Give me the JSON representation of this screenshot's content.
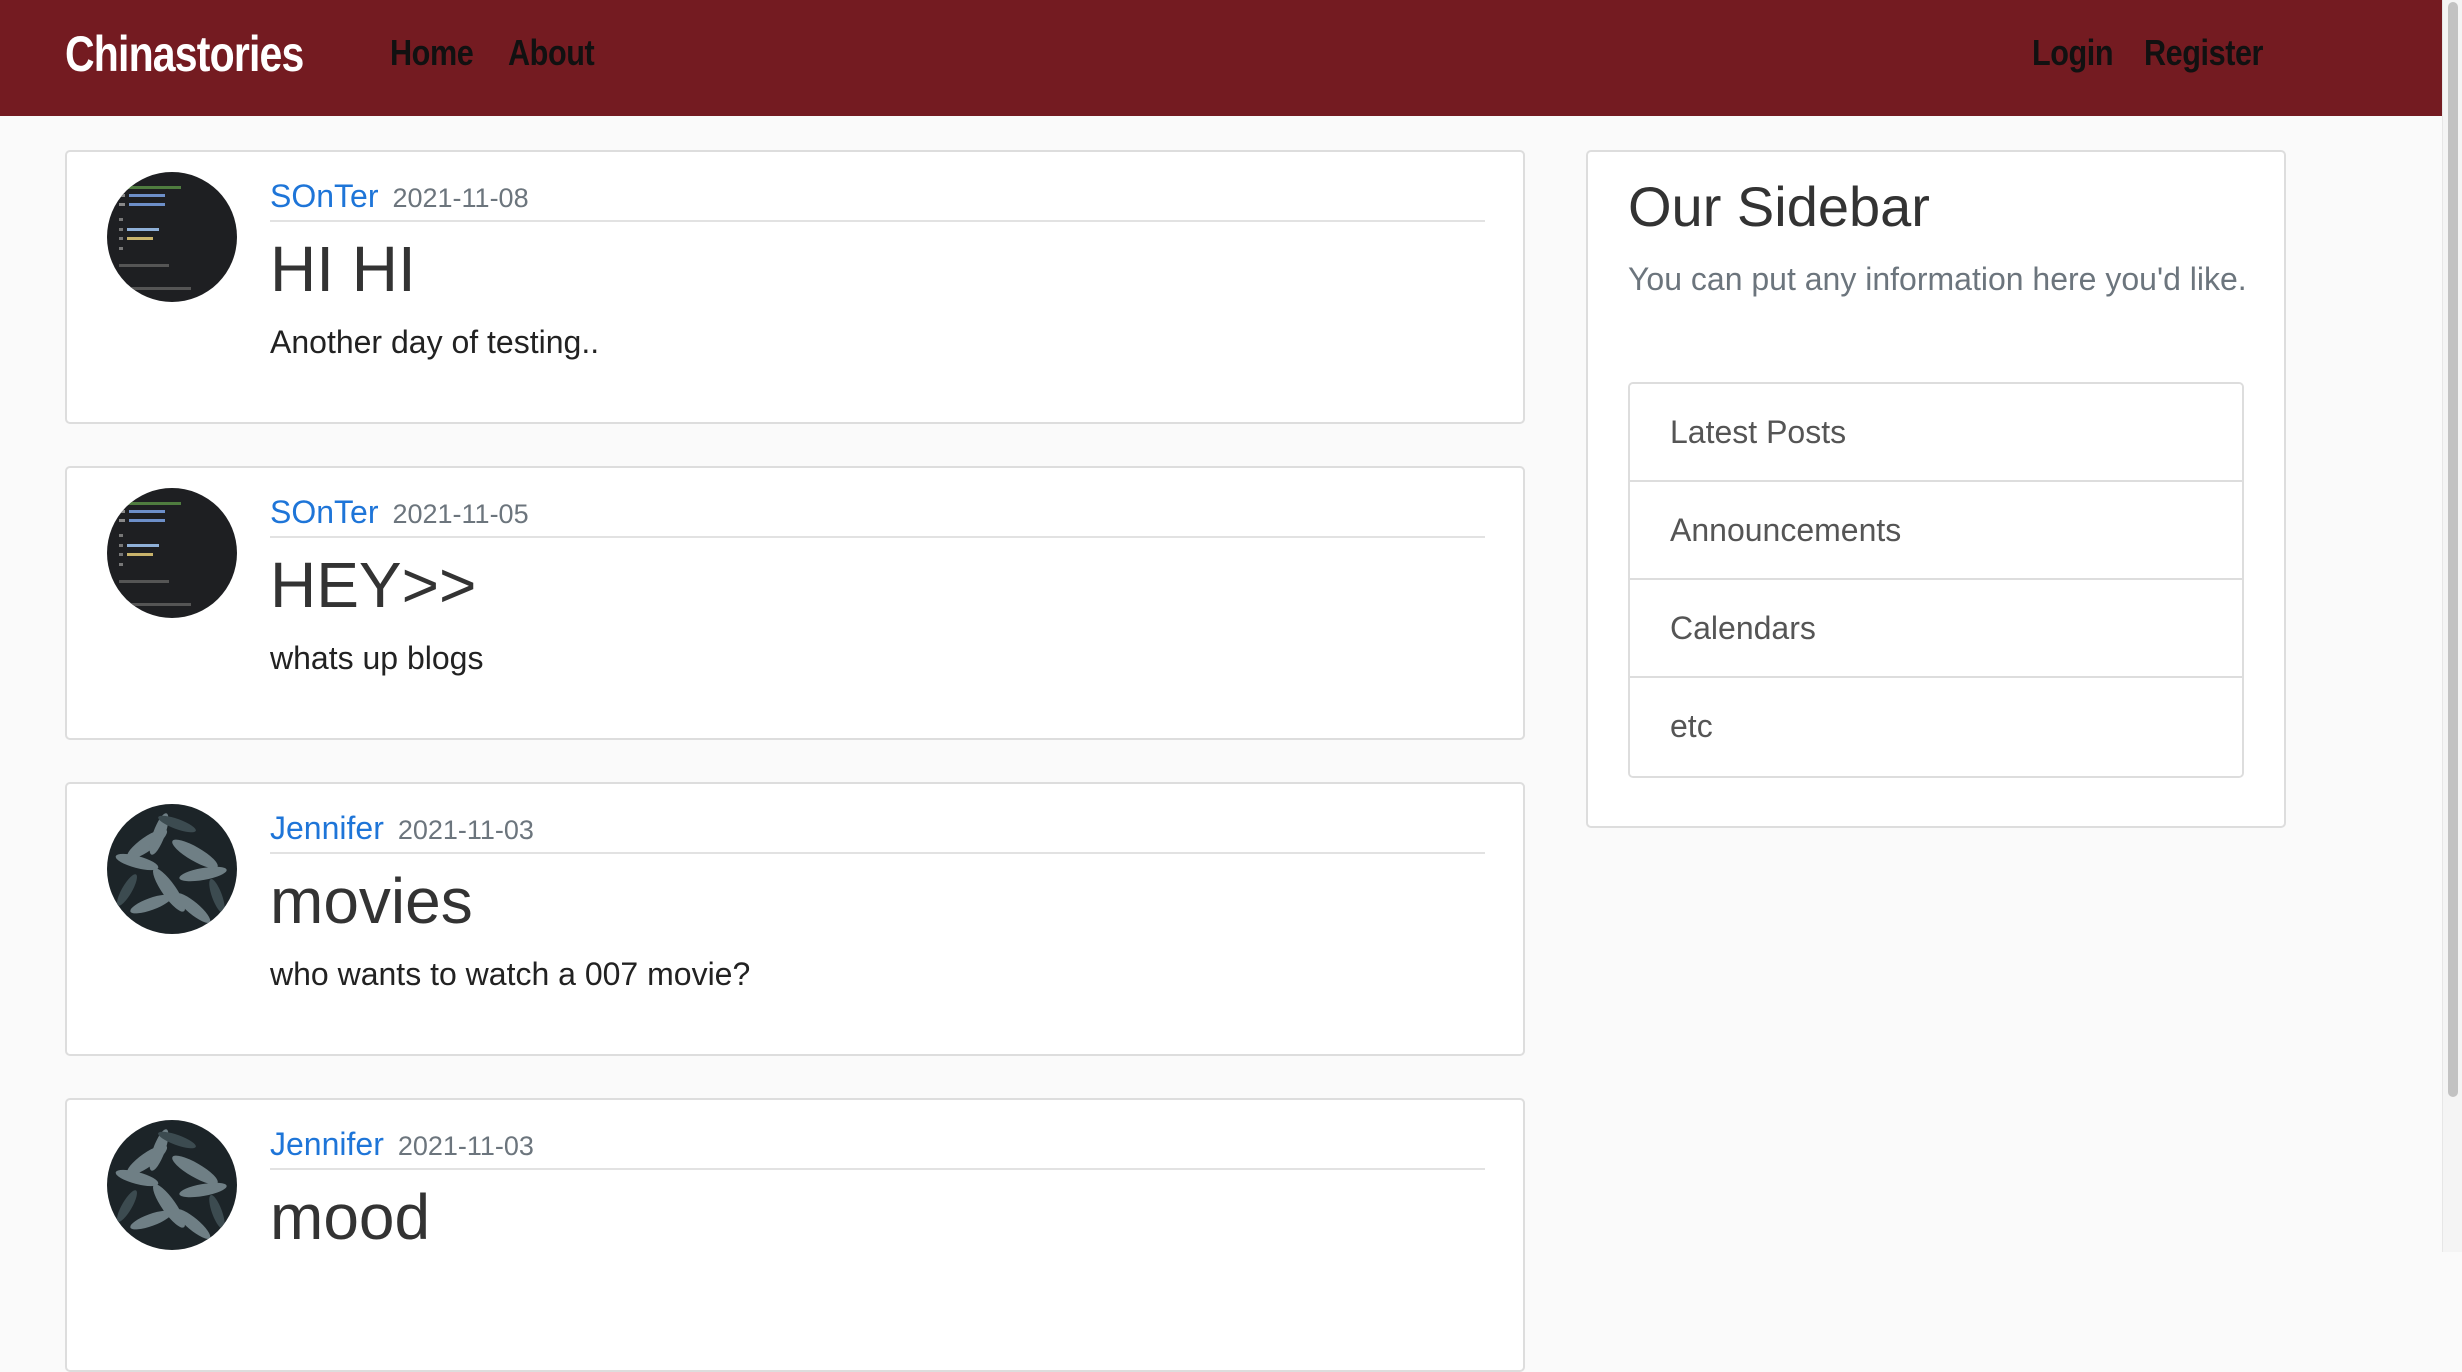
{
  "navbar": {
    "brand": "Chinastories",
    "home": "Home",
    "about": "About",
    "login": "Login",
    "register": "Register",
    "color": "#741b21"
  },
  "posts": [
    {
      "author": "SOnTer",
      "date": "2021-11-08",
      "title": "HI HI",
      "content": "Another day of testing..",
      "avatar": "code-screenshot"
    },
    {
      "author": "SOnTer",
      "date": "2021-11-05",
      "title": "HEY>>",
      "content": "whats up blogs",
      "avatar": "code-screenshot"
    },
    {
      "author": "Jennifer",
      "date": "2021-11-03",
      "title": "movies",
      "content": "who wants to watch a 007 movie?",
      "avatar": "dark-leaves"
    },
    {
      "author": "Jennifer",
      "date": "2021-11-03",
      "title": "mood",
      "content": "",
      "avatar": "dark-leaves"
    }
  ],
  "sidebar": {
    "title": "Our Sidebar",
    "text": "You can put any information here you'd like.",
    "items": [
      "Latest Posts",
      "Announcements",
      "Calendars",
      "etc"
    ]
  },
  "colors": {
    "link": "#1e75d8",
    "muted": "#6c757d",
    "background": "#fafafa"
  }
}
